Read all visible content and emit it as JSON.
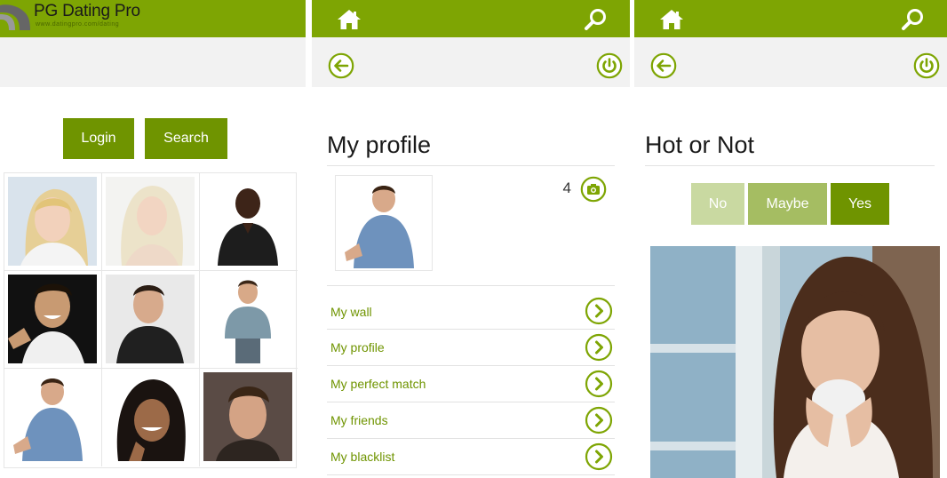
{
  "colors": {
    "brand": "#7ea503",
    "button": "#6f9400",
    "link": "#6f9400",
    "bar_light": "#f2f2f2"
  },
  "panel1": {
    "logo": {
      "name": "PG Dating Pro",
      "tagline": "www.datingpro.com/dating"
    },
    "buttons": {
      "login": "Login",
      "search": "Search"
    },
    "members_grid": {
      "rows": 3,
      "cols": 3
    }
  },
  "panel2": {
    "icons": {
      "home": "home-icon",
      "search": "search-icon",
      "back": "back-arrow-icon",
      "power": "power-icon",
      "camera": "camera-icon",
      "chevron": "chevron-right-icon"
    },
    "title": "My profile",
    "photo_count": "4",
    "menu": [
      {
        "label": "My wall"
      },
      {
        "label": "My profile"
      },
      {
        "label": "My perfect match"
      },
      {
        "label": "My friends"
      },
      {
        "label": "My blacklist"
      }
    ]
  },
  "panel3": {
    "title": "Hot or Not",
    "votes": {
      "no": "No",
      "maybe": "Maybe",
      "yes": "Yes"
    }
  }
}
